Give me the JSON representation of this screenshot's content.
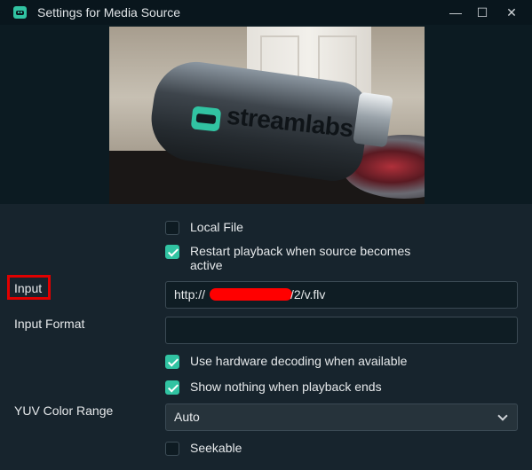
{
  "window": {
    "title": "Settings for Media Source",
    "minimize_glyph": "—",
    "maximize_glyph": "☐",
    "close_glyph": "✕"
  },
  "preview": {
    "brand_text": "streamlabs"
  },
  "form": {
    "local_file": {
      "label": "Local File",
      "checked": false
    },
    "restart_playback": {
      "label_line1": "Restart playback when source becomes",
      "label_line2": "active",
      "checked": true
    },
    "input": {
      "label": "Input",
      "value_prefix": "http://",
      "value_suffix": "/2/v.flv"
    },
    "input_format": {
      "label": "Input Format",
      "value": ""
    },
    "hardware_decoding": {
      "label": "Use hardware decoding when available",
      "checked": true
    },
    "show_nothing": {
      "label": "Show nothing when playback ends",
      "checked": true
    },
    "yuv_color_range": {
      "label": "YUV Color Range",
      "value": "Auto"
    },
    "seekable": {
      "label": "Seekable",
      "checked": false
    }
  },
  "colors": {
    "accent": "#31c3a2",
    "background": "#17242d",
    "titlebar": "#09161d",
    "highlight": "#e00000"
  }
}
